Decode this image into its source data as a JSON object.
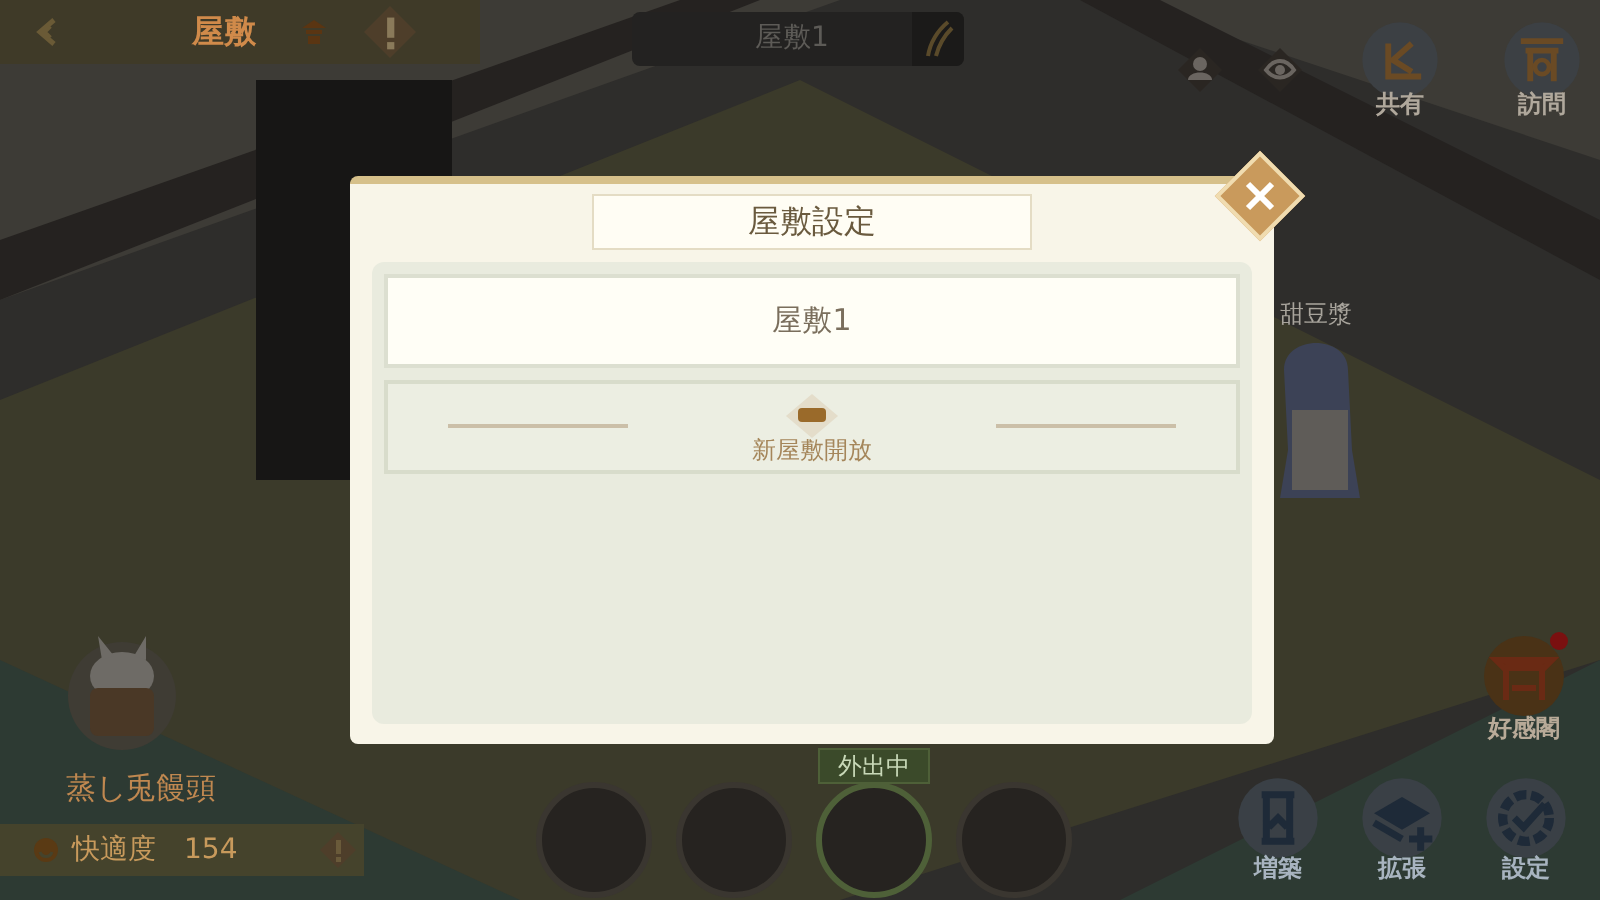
{
  "top_bar": {
    "title": "屋敷",
    "alert": true
  },
  "house_name_field": {
    "value": "屋敷1"
  },
  "top_right_buttons": [
    {
      "kind": "share",
      "label": "共有"
    },
    {
      "kind": "visit",
      "label": "訪問"
    }
  ],
  "scene": {
    "character_name": "甜豆漿"
  },
  "mascot": {
    "name": "蒸し兎饅頭",
    "comfort_label": "快適度",
    "comfort_value": "154"
  },
  "away_badge": "外出中",
  "characters": [
    {
      "away": false
    },
    {
      "away": false
    },
    {
      "away": true
    },
    {
      "away": false
    }
  ],
  "side_button": {
    "label": "好感閣",
    "notification": true
  },
  "bottom_buttons": [
    {
      "kind": "build",
      "label": "増築"
    },
    {
      "kind": "expand",
      "label": "拡張"
    },
    {
      "kind": "settings",
      "label": "設定"
    }
  ],
  "dialog": {
    "title": "屋敷設定",
    "houses": [
      {
        "kind": "house",
        "label": "屋敷1"
      },
      {
        "kind": "locked",
        "label": "新屋敷開放"
      }
    ]
  }
}
